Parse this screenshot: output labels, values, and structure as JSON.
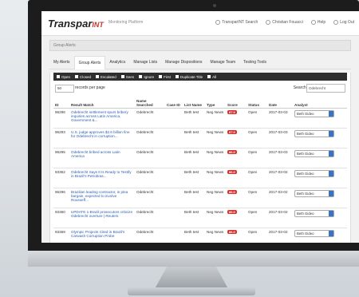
{
  "app": {
    "logo_main": "Transpar",
    "logo_accent": "INT",
    "logo_sub": "Monitoring Platform"
  },
  "topnav": [
    {
      "label": "TransparINT Search"
    },
    {
      "label": "Christian Fouacci"
    },
    {
      "label": "Help"
    },
    {
      "label": "Log Out"
    }
  ],
  "breadcrumb": "Group Alerts",
  "tabs": [
    {
      "label": "My Alerts"
    },
    {
      "label": "Group Alerts"
    },
    {
      "label": "Analytics"
    },
    {
      "label": "Manage Lists"
    },
    {
      "label": "Manage Dispositions"
    },
    {
      "label": "Manage Team"
    },
    {
      "label": "Testing Tools"
    }
  ],
  "filters": [
    "Open",
    "Closed",
    "Escalated",
    "Seen",
    "Ignore",
    "First",
    "Duplicate Title",
    "All"
  ],
  "controls": {
    "page_size": "50",
    "per_page_label": "records per page",
    "search_label": "Search:",
    "search_value": "Odebrecht"
  },
  "columns": [
    "ID",
    "Result Match",
    "Name Searched",
    "Case ID",
    "List Name",
    "Type",
    "Score",
    "Status",
    "Date",
    "Analyst"
  ],
  "rows": [
    {
      "id": "96296",
      "match": "Odebrecht settlement spurs bribery inquiries across Latin America, Government &...",
      "name": "Odebrecht",
      "case": "",
      "list": "Beth test",
      "type": "Neg News",
      "score": "87.0",
      "status": "Open",
      "date": "2017-03-03",
      "analyst": "Beth Gideo"
    },
    {
      "id": "96293",
      "match": "U.S. judge approves $2.6 billion fine for Odebrecht in corruption...",
      "name": "Odebrecht",
      "case": "",
      "list": "Beth test",
      "type": "Neg News",
      "score": "87.0",
      "status": "Open",
      "date": "2017-03-03",
      "analyst": "Beth Gideo"
    },
    {
      "id": "96295",
      "match": "Odebrecht bribed across Latin America",
      "name": "Odebrecht",
      "case": "",
      "list": "Beth test",
      "type": "Neg News",
      "score": "86.0",
      "status": "Open",
      "date": "2017-03-03",
      "analyst": "Beth Gideo"
    },
    {
      "id": "93362",
      "match": "Odebrecht Says It Is Ready to Testify in Brazil's Petrobras...",
      "name": "Odebrecht",
      "case": "",
      "list": "Beth test",
      "type": "Neg News",
      "score": "86.0",
      "status": "Open",
      "date": "2017-03-02",
      "analyst": "Beth Gideo"
    },
    {
      "id": "96296",
      "match": "Brazilian leading contractor, in plea bargain, expected to involve Rousseff...",
      "name": "Odebrecht",
      "case": "",
      "list": "Beth test",
      "type": "Neg News",
      "score": "86.0",
      "status": "Open",
      "date": "2017-03-02",
      "analyst": "Beth Gideo"
    },
    {
      "id": "93360",
      "match": "UPDATE 1-Brazil prosecutors criticize Odebrecht overture | Reuters",
      "name": "Odebrecht",
      "case": "",
      "list": "Beth test",
      "type": "Neg News",
      "score": "86.0",
      "status": "Open",
      "date": "2017-03-02",
      "analyst": "Beth Gideo"
    },
    {
      "id": "93369",
      "match": "Olympic Projects Cited in Brazil's Carwash Corruption Probe",
      "name": "Odebrecht",
      "case": "",
      "list": "Beth test",
      "type": "Neg News",
      "score": "86.0",
      "status": "Open",
      "date": "2017-03-02",
      "analyst": "Beth Gideo"
    }
  ],
  "colors": {
    "score_badge": "#d9302c",
    "filter_bar": "#2e2e2e",
    "link": "#2a5db0"
  }
}
